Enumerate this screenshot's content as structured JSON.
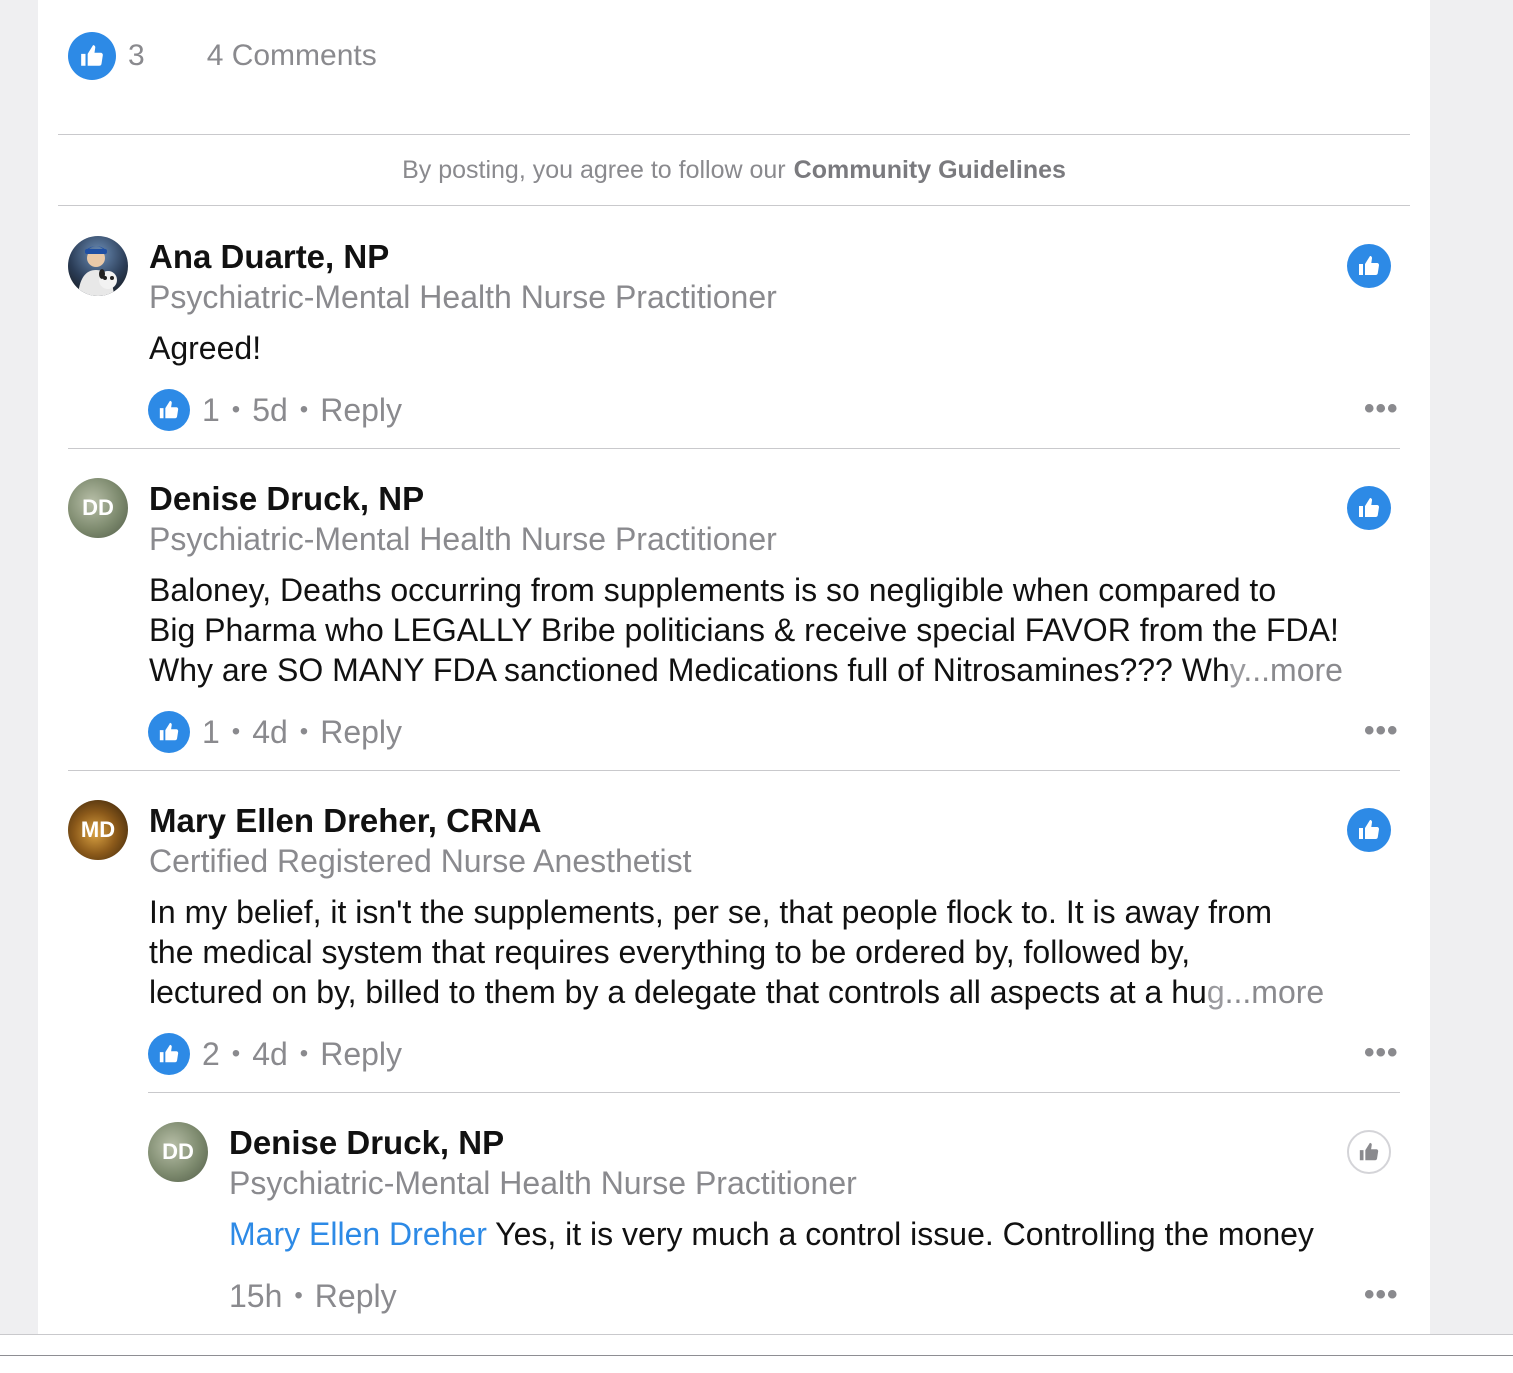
{
  "summary": {
    "like_count": "3",
    "comments_label": "4 Comments"
  },
  "guidelines": {
    "prefix": "By posting, you agree to follow our",
    "link": "Community Guidelines"
  },
  "comments": [
    {
      "name": "Ana Duarte, NP",
      "title": "Psychiatric-Mental Health Nurse Practitioner",
      "lines": [
        "Agreed!"
      ],
      "likes": "1",
      "time": "5d",
      "reply": "Reply"
    },
    {
      "initials": "DD",
      "name": "Denise Druck, NP",
      "title": "Psychiatric-Mental Health Nurse Practitioner",
      "lines": [
        "Baloney, Deaths occurring from supplements is so negligible when compared to",
        "Big Pharma who LEGALLY Bribe politicians & receive special FAVOR from the FDA!",
        "Why are SO MANY FDA sanctioned Medications full of Nitrosamines??? Wh"
      ],
      "fade": "y",
      "more": "...more",
      "likes": "1",
      "time": "4d",
      "reply": "Reply"
    },
    {
      "initials": "MD",
      "name": "Mary Ellen Dreher, CRNA",
      "title": "Certified Registered Nurse Anesthetist",
      "lines": [
        "In my belief, it isn't the supplements, per se, that people flock to. It is away from",
        "the medical system that requires everything to be ordered by, followed by,",
        "lectured on by, billed to them by a delegate that controls all aspects at a hu"
      ],
      "fade": "g",
      "more": "...more",
      "likes": "2",
      "time": "4d",
      "reply": "Reply"
    }
  ],
  "reply": {
    "initials": "DD",
    "name": "Denise Druck, NP",
    "title": "Psychiatric-Mental Health Nurse Practitioner",
    "mention": "Mary Ellen Dreher",
    "text": " Yes, it is very much a control issue. Controlling the money",
    "time": "15h",
    "reply": "Reply"
  },
  "icons": {
    "like": "thumbs-up-icon",
    "more": "more-options-icon"
  },
  "colors": {
    "accent": "#2d8ae6",
    "muted": "#8a8a8e",
    "text": "#111111"
  }
}
